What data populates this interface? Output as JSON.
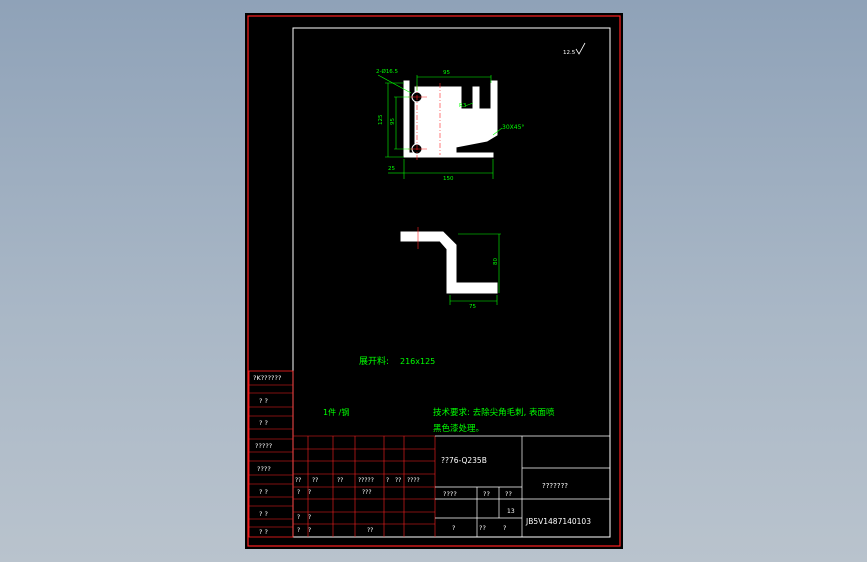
{
  "colors": {
    "background": "#000000",
    "outer_frame": "#ff2020",
    "inner_frame": "#ffffff",
    "part": "#ffffff",
    "dimension": "#00ff00",
    "centerline": "#ff2020",
    "annotation_text": "#00ff00",
    "table_text": "#ffffff",
    "desktop": "#a0b0c2"
  },
  "roughness": {
    "text": "12.5"
  },
  "top_view": {
    "hole_label": "2-Ø16.5",
    "dim_top": "95",
    "dim_left_outer": "125",
    "dim_left_inner": "95",
    "dim_radius": "R3",
    "chamfer": "30X45°",
    "dim_bottom_small": "25",
    "dim_bottom": "150"
  },
  "side_view": {
    "dim_height": "80",
    "dim_width": "75"
  },
  "notes": {
    "blank_label": "展开料:",
    "blank_value": "216x125",
    "part_qty": "1件 /钢",
    "tech_line1": "技术要求: 去除尖角毛刺, 表面喷",
    "tech_line2": "黑色漆处理。"
  },
  "side_table": [
    "?K??????",
    "?  ?",
    "?  ?",
    "?????",
    "????",
    "?  ?",
    "?  ?",
    "?  ?"
  ],
  "title_block": {
    "material": "??76-Q235B",
    "drawing_name": "???????",
    "drawing_number": "JB5V1487140103",
    "scale_row": [
      "????",
      "??",
      "??"
    ],
    "sheet": "13",
    "bottom_row": [
      "?",
      "??",
      "?"
    ],
    "sign_rows": [
      [
        "??",
        "??",
        "??",
        "?????",
        "?",
        "??",
        "????"
      ],
      [
        "?",
        "?",
        "",
        "???",
        "",
        ""
      ],
      [
        "?",
        "?",
        "",
        "",
        "",
        ""
      ],
      [
        "?",
        "?",
        "",
        "??",
        "",
        ""
      ]
    ]
  }
}
